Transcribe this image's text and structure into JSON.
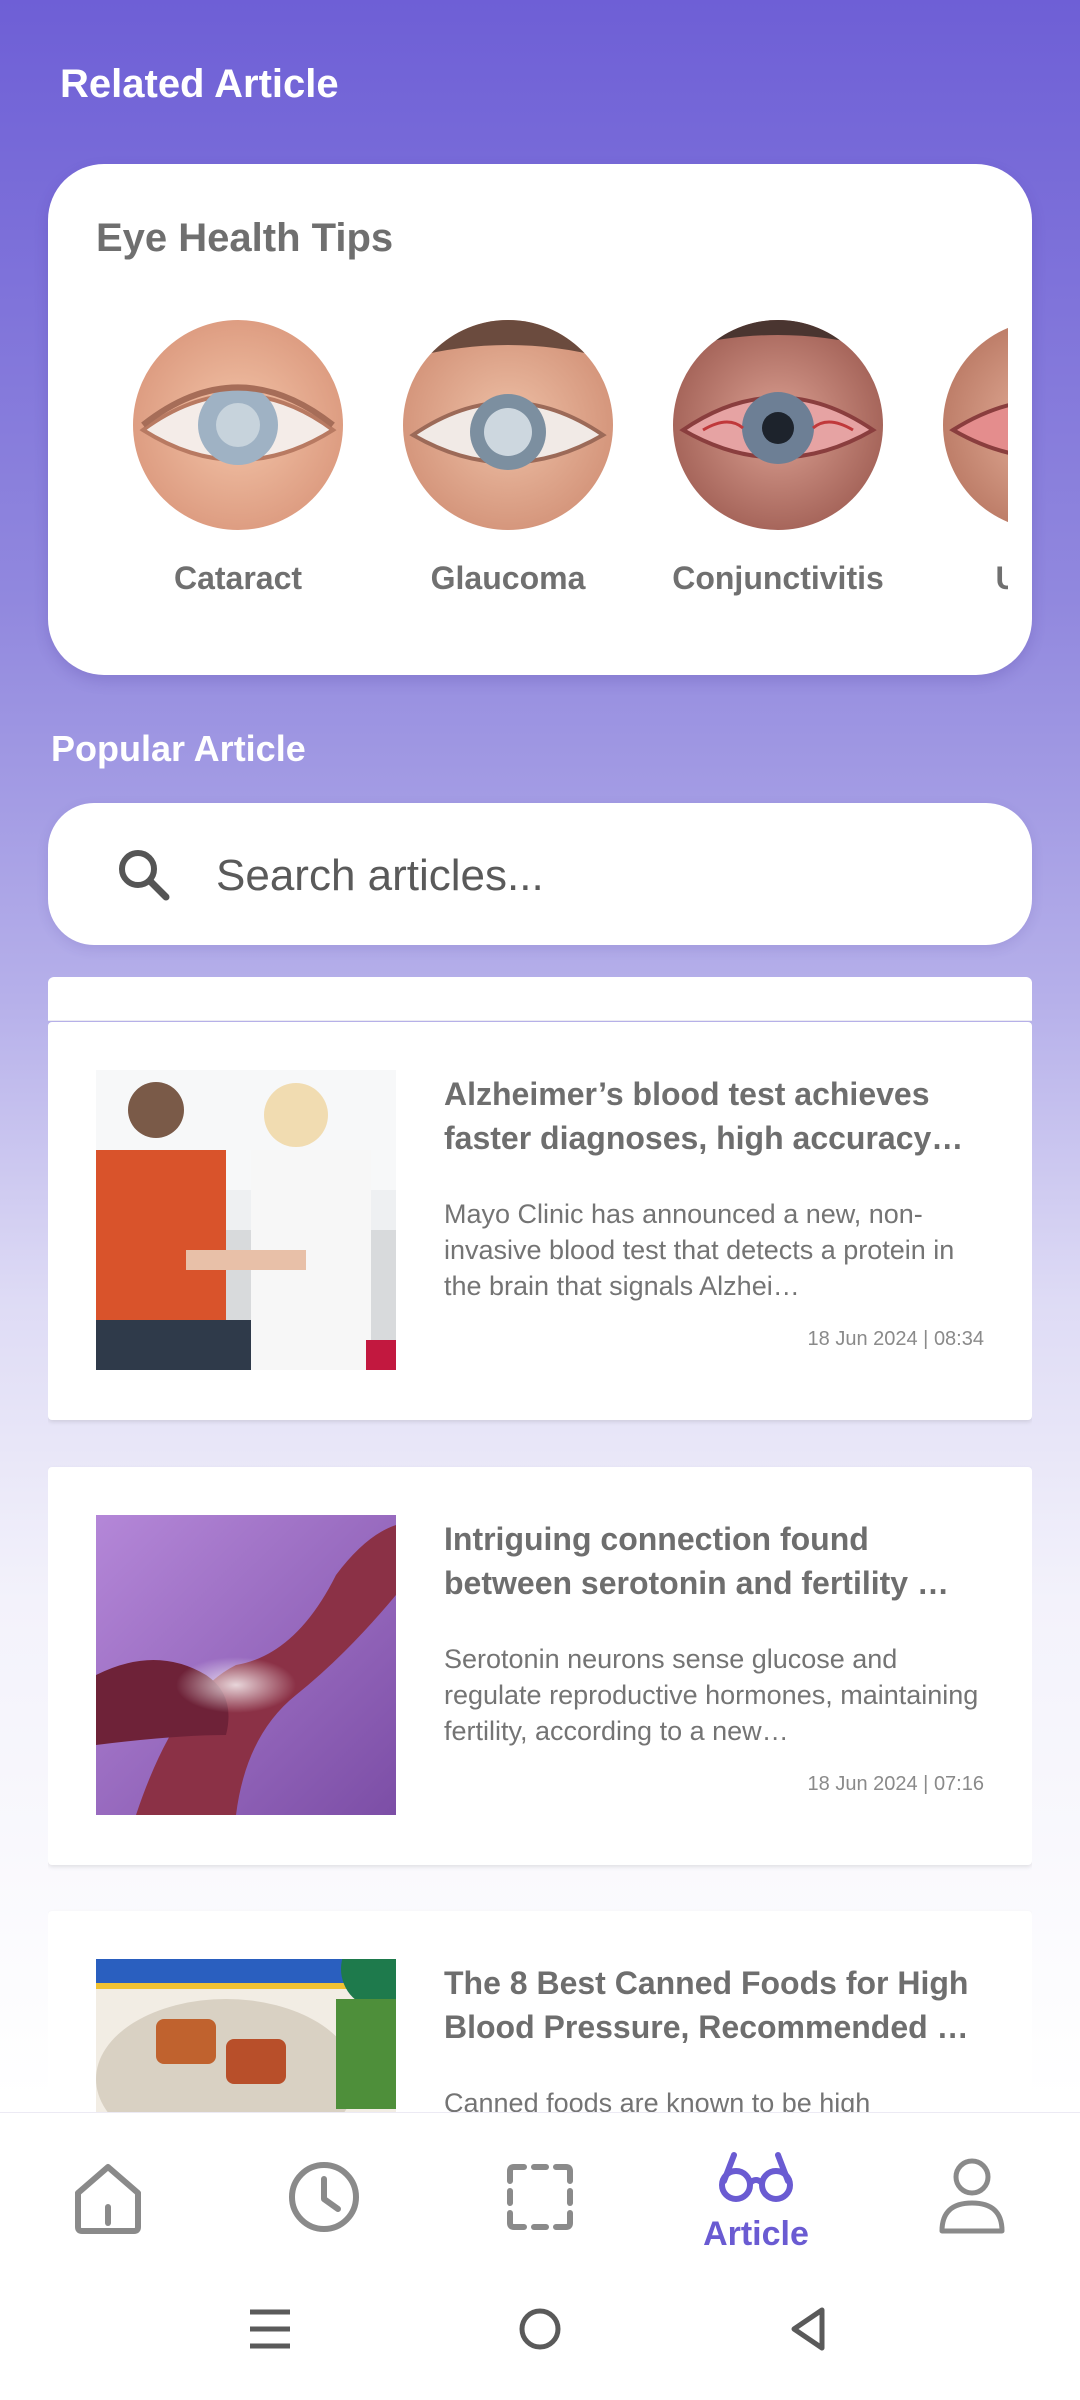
{
  "related": {
    "title": "Related Article",
    "card_title": "Eye Health Tips",
    "items": [
      {
        "label": "Cataract",
        "icon": "cataract-eye-photo"
      },
      {
        "label": "Glaucoma",
        "icon": "glaucoma-eye-photo"
      },
      {
        "label": "Conjunctivitis",
        "icon": "conjunctivitis-eye-photo"
      },
      {
        "label": "Uveitis",
        "icon": "uveitis-eye-photo"
      }
    ]
  },
  "popular": {
    "title": "Popular Article",
    "search": {
      "placeholder": "Search articles...",
      "value": "",
      "icon": "search-icon"
    },
    "articles": [
      {
        "title": "Alzheimer’s blood test achieves faster diagnoses, high accuracy…",
        "description": "Mayo Clinic has announced a new, non-invasive blood test that detects a protein in the brain that signals Alzhei…",
        "date": "18 Jun 2024 | 08:34",
        "image": "blood-test-photo"
      },
      {
        "title": "Intriguing connection found between serotonin and fertility …",
        "description": "Serotonin neurons sense glucose and regulate reproductive hormones, maintaining fertility, according to a new…",
        "date": "18 Jun 2024 | 07:16",
        "image": "neuron-illustration"
      },
      {
        "title": "The 8 Best Canned Foods for High Blood Pressure, Recommended …",
        "description": "Canned foods are known to be high",
        "date": "",
        "image": "canned-food-photo"
      }
    ]
  },
  "bottom_nav": {
    "items": [
      {
        "name": "home",
        "icon": "home-icon",
        "label": ""
      },
      {
        "name": "history",
        "icon": "clock-icon",
        "label": ""
      },
      {
        "name": "scan",
        "icon": "scan-icon",
        "label": ""
      },
      {
        "name": "article",
        "icon": "glasses-icon",
        "label": "Article",
        "active": true
      },
      {
        "name": "profile",
        "icon": "user-icon",
        "label": ""
      }
    ],
    "active_color": "#6a5bd2",
    "inactive_color": "#8a8a8a"
  },
  "system_nav": {
    "icons": [
      "menu-icon",
      "home-circle-icon",
      "back-icon"
    ]
  }
}
